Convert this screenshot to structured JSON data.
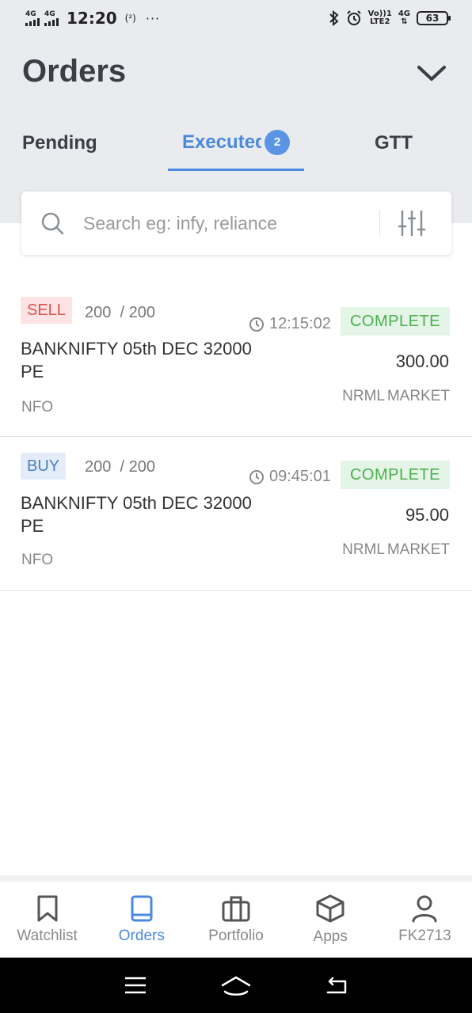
{
  "status_bar": {
    "network_1": "4G",
    "network_2": "4G",
    "time": "12:20",
    "hotspot": "(²)",
    "dots": "···",
    "volte_label": "Vo))1",
    "lte_label": "LTE2",
    "network_3": "4G",
    "battery": "63"
  },
  "header": {
    "title": "Orders"
  },
  "tabs": [
    {
      "label": "Pending"
    },
    {
      "label": "Executed",
      "badge": "2"
    },
    {
      "label": "GTT"
    }
  ],
  "search": {
    "placeholder": "Search eg: infy, reliance"
  },
  "orders": [
    {
      "side": "SELL",
      "qty": "200",
      "qty_total": "/ 200",
      "time": "12:15:02",
      "status": "COMPLETE",
      "symbol": "BANKNIFTY 05th DEC 32000 PE",
      "price": "300.00",
      "exchange": "NFO",
      "product": "NRML",
      "order_type": "MARKET"
    },
    {
      "side": "BUY",
      "qty": "200",
      "qty_total": "/ 200",
      "time": "09:45:01",
      "status": "COMPLETE",
      "symbol": "BANKNIFTY 05th DEC 32000 PE",
      "price": "95.00",
      "exchange": "NFO",
      "product": "NRML",
      "order_type": "MARKET"
    }
  ],
  "bottom_nav": [
    {
      "label": "Watchlist",
      "icon": "bookmark-icon"
    },
    {
      "label": "Orders",
      "icon": "book-icon"
    },
    {
      "label": "Portfolio",
      "icon": "briefcase-icon"
    },
    {
      "label": "Apps",
      "icon": "cube-icon"
    },
    {
      "label": "FK2713",
      "icon": "user-icon"
    }
  ],
  "colors": {
    "accent": "#4a89dc",
    "sell": "#d9534f",
    "buy": "#4a7fc1",
    "complete": "#4caf50",
    "header_bg": "#e9ebee"
  }
}
